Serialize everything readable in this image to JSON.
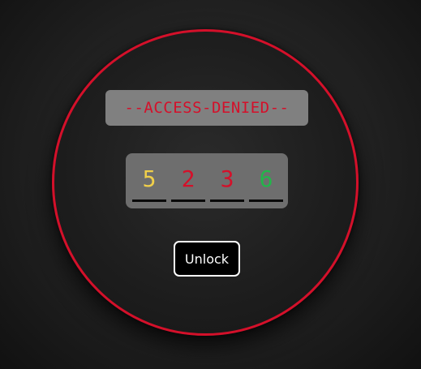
{
  "status": {
    "text": "--ACCESS-DENIED--",
    "color": "#d4102a"
  },
  "code": {
    "digits": [
      {
        "value": "5",
        "color": "#f0cf4a"
      },
      {
        "value": "2",
        "color": "#d4102a"
      },
      {
        "value": "3",
        "color": "#d4102a"
      },
      {
        "value": "6",
        "color": "#22b64a"
      }
    ]
  },
  "actions": {
    "unlock_label": "Unlock"
  },
  "theme": {
    "ring_color": "#d4102a",
    "panel_color": "#808080",
    "code_panel_color": "#6e6e6e"
  }
}
